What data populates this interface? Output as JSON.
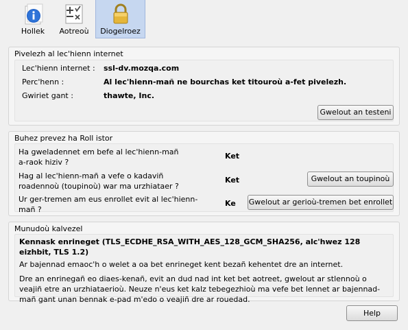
{
  "tabs": [
    {
      "label": "Hollek",
      "icon": "info-icon"
    },
    {
      "label": "Aotreoù",
      "icon": "permissions-icon"
    },
    {
      "label": "Diogelroez",
      "icon": "lock-icon"
    }
  ],
  "identity": {
    "title": "Pivelezh al lec'hienn internet",
    "website_label": "Lec'hienn internet :",
    "website_value": "ssl-dv.mozqa.com",
    "owner_label": "Perc'henn :",
    "owner_value": "Al lec'hienn-mañ ne bourchas ket titouroù a-fet pivelezh.",
    "verified_label": "Gwiriet gant :",
    "verified_value": "thawte, Inc.",
    "view_cert_button": "Gwelout an testeni"
  },
  "privacy": {
    "title": "Buhez prevez ha Roll istor",
    "q1": "Ha gweladennet em befe al lec'hienn-mañ a-raok hiziv ?",
    "a1": "Ket",
    "q2": "Hag al lec'hienn-mañ a vefe o kadaviñ roadennoù (toupinoù) war ma urzhiataer ?",
    "a2": "Ket",
    "cookies_button": "Gwelout an toupinoù",
    "q3": "Ur ger-tremen am eus enrollet evit al lec'hienn-mañ ?",
    "a3": "Ke",
    "passwords_button": "Gwelout ar gerioù-tremen bet enrollet"
  },
  "technical": {
    "title": "Munudoù kalvezel",
    "cipher": "Kennask enrineget (TLS_ECDHE_RSA_WITH_AES_128_GCM_SHA256, alc'hwez 128 eizhbit, TLS 1.2)",
    "line1": "Ar bajennad emaoc'h o welet a oa bet enrineget kent bezañ kehentet dre an internet.",
    "line2": "Dre an enrinegañ eo diaes-kenañ, evit an dud nad int ket bet aotreet, gwelout ar stlennoù o veajiñ etre an urzhiataerioù. Neuze n'eus ket kalz tebegezhioù ma vefe bet lennet ar bajennad-mañ gant unan bennak e-pad m'edo o veajiñ dre ar rouedad."
  },
  "help_button": "Help"
}
